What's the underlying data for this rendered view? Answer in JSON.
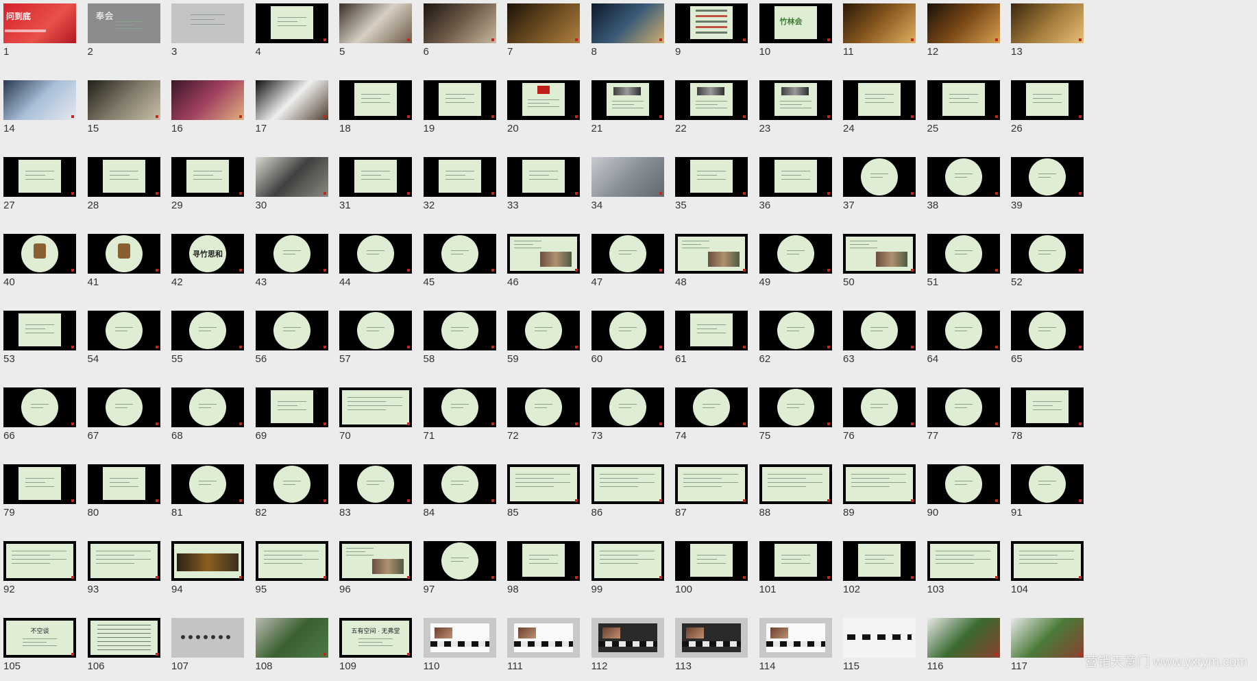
{
  "slides": [
    {
      "n": "1",
      "kind": "cover"
    },
    {
      "n": "2",
      "kind": "gray-title",
      "text": "奉会"
    },
    {
      "n": "3",
      "kind": "lightgray"
    },
    {
      "n": "4",
      "kind": "card-center"
    },
    {
      "n": "5",
      "kind": "photo",
      "palette": [
        "#3a2f28",
        "#d8d0c4",
        "#6b5a48"
      ]
    },
    {
      "n": "6",
      "kind": "photo",
      "palette": [
        "#1c1612",
        "#6e5a48",
        "#c8b8a0"
      ]
    },
    {
      "n": "7",
      "kind": "photo",
      "palette": [
        "#1a1208",
        "#6a4a20",
        "#b08040"
      ]
    },
    {
      "n": "8",
      "kind": "photo",
      "palette": [
        "#0e1a2a",
        "#3a5a78",
        "#d0b070"
      ]
    },
    {
      "n": "9",
      "kind": "card-list"
    },
    {
      "n": "10",
      "kind": "card-logo",
      "text": "竹林会"
    },
    {
      "n": "11",
      "kind": "photo",
      "palette": [
        "#2a1808",
        "#8a5a20",
        "#e0b060"
      ]
    },
    {
      "n": "12",
      "kind": "photo",
      "palette": [
        "#1a1008",
        "#7a4a18",
        "#d8a050"
      ]
    },
    {
      "n": "13",
      "kind": "photo",
      "palette": [
        "#3a2810",
        "#a07838",
        "#e8c078"
      ]
    },
    {
      "n": "14",
      "kind": "photo",
      "palette": [
        "#2a3850",
        "#a8c0d8",
        "#e8e8f0"
      ]
    },
    {
      "n": "15",
      "kind": "photo",
      "palette": [
        "#202018",
        "#807868",
        "#c8c0a8"
      ]
    },
    {
      "n": "16",
      "kind": "photo",
      "palette": [
        "#3a1828",
        "#a04060",
        "#e0b080"
      ]
    },
    {
      "n": "17",
      "kind": "photo",
      "palette": [
        "#101010",
        "#f0f0f0",
        "#504030"
      ]
    },
    {
      "n": "18",
      "kind": "card"
    },
    {
      "n": "19",
      "kind": "card"
    },
    {
      "n": "20",
      "kind": "card-redimg"
    },
    {
      "n": "21",
      "kind": "card-img"
    },
    {
      "n": "22",
      "kind": "card-img"
    },
    {
      "n": "23",
      "kind": "card-img"
    },
    {
      "n": "24",
      "kind": "card"
    },
    {
      "n": "25",
      "kind": "card"
    },
    {
      "n": "26",
      "kind": "card"
    },
    {
      "n": "27",
      "kind": "card"
    },
    {
      "n": "28",
      "kind": "card"
    },
    {
      "n": "29",
      "kind": "card"
    },
    {
      "n": "30",
      "kind": "photo",
      "palette": [
        "#d8d8d0",
        "#404040",
        "#8a8a80"
      ]
    },
    {
      "n": "31",
      "kind": "card"
    },
    {
      "n": "32",
      "kind": "card"
    },
    {
      "n": "33",
      "kind": "card"
    },
    {
      "n": "34",
      "kind": "photo",
      "palette": [
        "#c8ccd0",
        "#8a9098",
        "#606870"
      ]
    },
    {
      "n": "35",
      "kind": "card"
    },
    {
      "n": "36",
      "kind": "card"
    },
    {
      "n": "37",
      "kind": "circle"
    },
    {
      "n": "38",
      "kind": "circle"
    },
    {
      "n": "39",
      "kind": "circle"
    },
    {
      "n": "40",
      "kind": "circle-img"
    },
    {
      "n": "41",
      "kind": "circle-img"
    },
    {
      "n": "42",
      "kind": "circle-text",
      "text": "寻竹思和"
    },
    {
      "n": "43",
      "kind": "circle"
    },
    {
      "n": "44",
      "kind": "circle"
    },
    {
      "n": "45",
      "kind": "circle"
    },
    {
      "n": "46",
      "kind": "wide-img"
    },
    {
      "n": "47",
      "kind": "circle"
    },
    {
      "n": "48",
      "kind": "wide-img"
    },
    {
      "n": "49",
      "kind": "circle"
    },
    {
      "n": "50",
      "kind": "wide-img"
    },
    {
      "n": "51",
      "kind": "circle"
    },
    {
      "n": "52",
      "kind": "circle"
    },
    {
      "n": "53",
      "kind": "card"
    },
    {
      "n": "54",
      "kind": "circle"
    },
    {
      "n": "55",
      "kind": "circle"
    },
    {
      "n": "56",
      "kind": "circle"
    },
    {
      "n": "57",
      "kind": "circle"
    },
    {
      "n": "58",
      "kind": "circle"
    },
    {
      "n": "59",
      "kind": "circle"
    },
    {
      "n": "60",
      "kind": "circle"
    },
    {
      "n": "61",
      "kind": "card"
    },
    {
      "n": "62",
      "kind": "circle"
    },
    {
      "n": "63",
      "kind": "circle"
    },
    {
      "n": "64",
      "kind": "circle"
    },
    {
      "n": "65",
      "kind": "circle"
    },
    {
      "n": "66",
      "kind": "circle"
    },
    {
      "n": "67",
      "kind": "circle"
    },
    {
      "n": "68",
      "kind": "circle"
    },
    {
      "n": "69",
      "kind": "card"
    },
    {
      "n": "70",
      "kind": "wide"
    },
    {
      "n": "71",
      "kind": "circle"
    },
    {
      "n": "72",
      "kind": "circle"
    },
    {
      "n": "73",
      "kind": "circle"
    },
    {
      "n": "74",
      "kind": "circle"
    },
    {
      "n": "75",
      "kind": "circle"
    },
    {
      "n": "76",
      "kind": "circle"
    },
    {
      "n": "77",
      "kind": "circle"
    },
    {
      "n": "78",
      "kind": "card"
    },
    {
      "n": "79",
      "kind": "card"
    },
    {
      "n": "80",
      "kind": "card"
    },
    {
      "n": "81",
      "kind": "circle"
    },
    {
      "n": "82",
      "kind": "circle"
    },
    {
      "n": "83",
      "kind": "circle"
    },
    {
      "n": "84",
      "kind": "circle"
    },
    {
      "n": "85",
      "kind": "wide"
    },
    {
      "n": "86",
      "kind": "wide"
    },
    {
      "n": "87",
      "kind": "wide"
    },
    {
      "n": "88",
      "kind": "wide"
    },
    {
      "n": "89",
      "kind": "wide"
    },
    {
      "n": "90",
      "kind": "circle"
    },
    {
      "n": "91",
      "kind": "circle"
    },
    {
      "n": "92",
      "kind": "wide"
    },
    {
      "n": "93",
      "kind": "wide"
    },
    {
      "n": "94",
      "kind": "wide-dark"
    },
    {
      "n": "95",
      "kind": "wide"
    },
    {
      "n": "96",
      "kind": "wide-img"
    },
    {
      "n": "97",
      "kind": "circle"
    },
    {
      "n": "98",
      "kind": "card"
    },
    {
      "n": "99",
      "kind": "wide"
    },
    {
      "n": "100",
      "kind": "card"
    },
    {
      "n": "101",
      "kind": "card"
    },
    {
      "n": "102",
      "kind": "card"
    },
    {
      "n": "103",
      "kind": "wide"
    },
    {
      "n": "104",
      "kind": "wide"
    },
    {
      "n": "105",
      "kind": "wide-title",
      "text": "不空谈"
    },
    {
      "n": "106",
      "kind": "wide-table"
    },
    {
      "n": "107",
      "kind": "gray-icons"
    },
    {
      "n": "108",
      "kind": "photo",
      "palette": [
        "#b8b8b0",
        "#3a6030",
        "#507848"
      ]
    },
    {
      "n": "109",
      "kind": "wide-title",
      "text": "五有空间 · 无弗堂"
    },
    {
      "n": "110",
      "kind": "frame-gray"
    },
    {
      "n": "111",
      "kind": "frame-gray"
    },
    {
      "n": "112",
      "kind": "frame-gray-dark"
    },
    {
      "n": "113",
      "kind": "frame-gray-dark"
    },
    {
      "n": "114",
      "kind": "frame-gray"
    },
    {
      "n": "115",
      "kind": "white-strip"
    },
    {
      "n": "116",
      "kind": "photo",
      "palette": [
        "#e8e8e8",
        "#3a6a30",
        "#8a4030"
      ]
    },
    {
      "n": "117",
      "kind": "photo",
      "palette": [
        "#e8e8e8",
        "#4a7a38",
        "#8a4030"
      ]
    }
  ],
  "watermark": "营销天意门 www.yxrym.com"
}
